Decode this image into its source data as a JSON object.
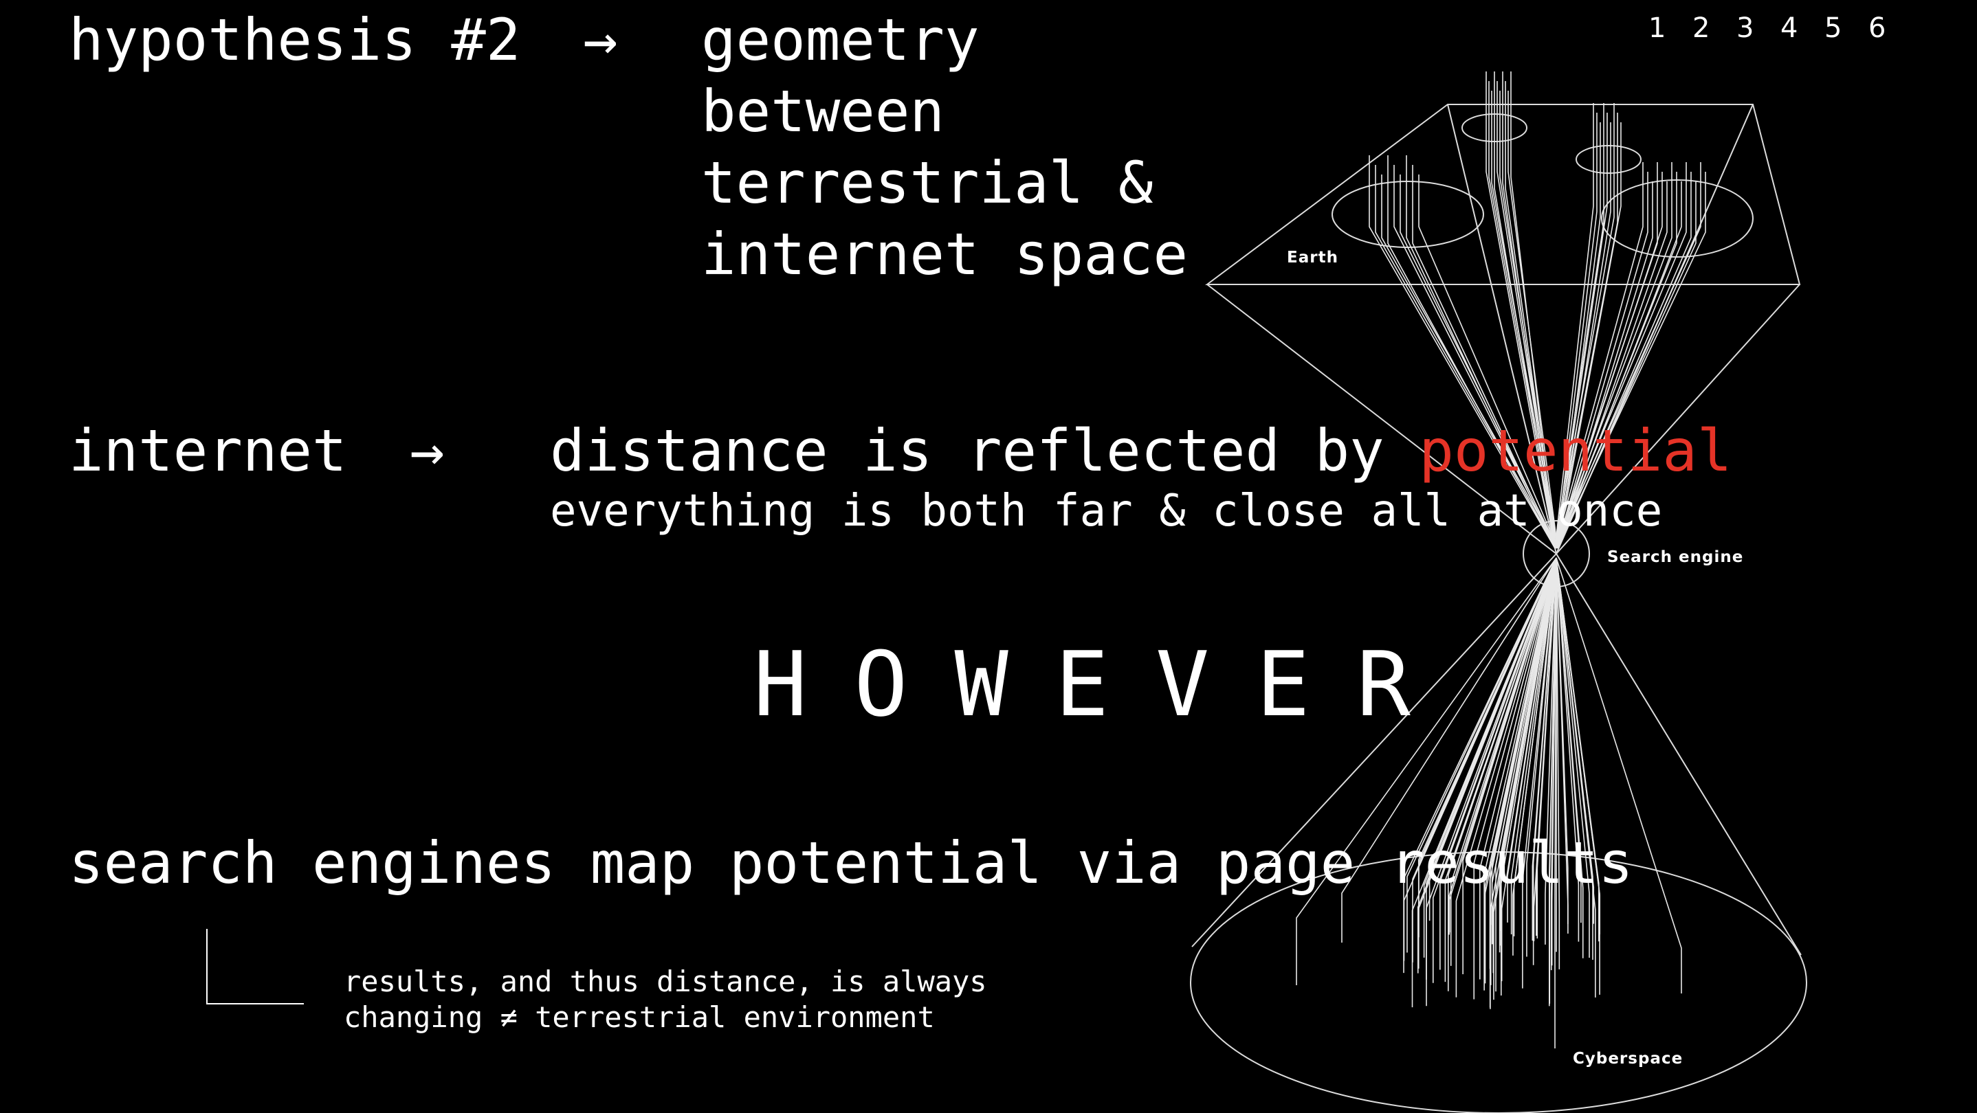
{
  "nav": {
    "pages": [
      "1",
      "2",
      "3",
      "4",
      "5",
      "6"
    ]
  },
  "hypothesis": {
    "label": "hypothesis #2",
    "arrow": "→",
    "lines": [
      "geometry",
      "between",
      "terrestrial &",
      "internet space"
    ]
  },
  "internet": {
    "label": "internet",
    "arrow": "→",
    "statement_prefix": "distance is reflected by ",
    "statement_highlight": "potential",
    "subtext": "everything is both far & close all at once"
  },
  "however": "HOWEVER",
  "search": {
    "headline": "search engines map potential via page results",
    "note_line1": "results, and thus distance, is always",
    "note_line2": "changing ≠ terrestrial environment"
  },
  "diagram": {
    "label_top": "Earth",
    "label_middle": "Search engine",
    "label_bottom": "Cyberspace"
  },
  "colors": {
    "background": "#000000",
    "text": "#ffffff",
    "highlight": "#e53327"
  }
}
